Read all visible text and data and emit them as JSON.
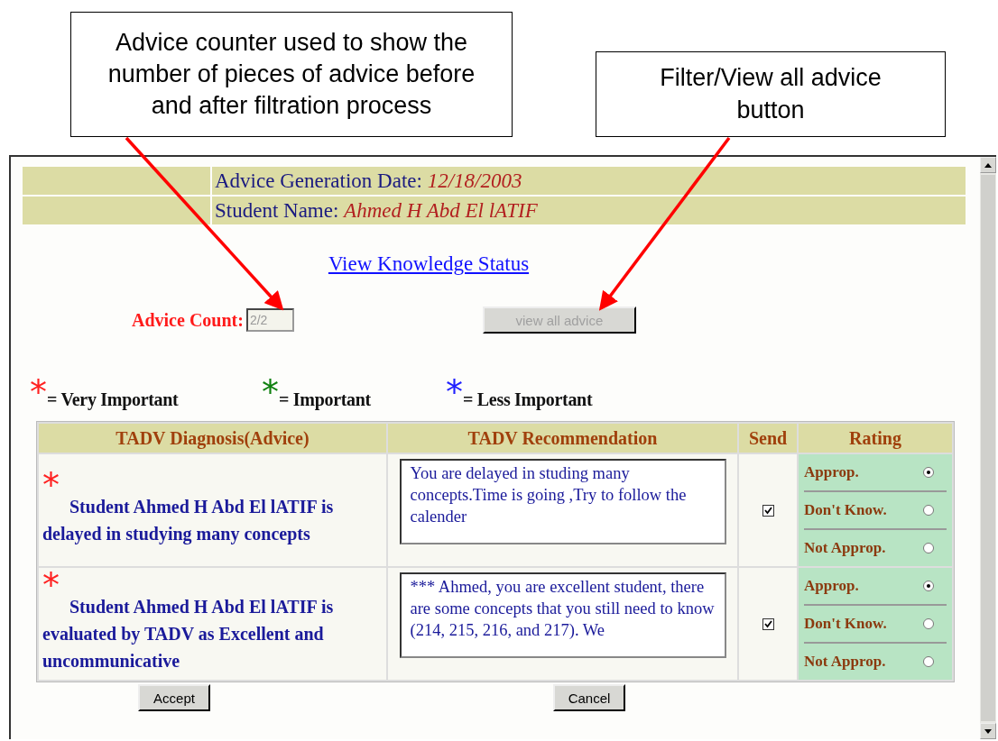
{
  "callouts": [
    {
      "text": "Advice counter used to show the number of pieces of advice before and after filtration process"
    },
    {
      "text": "Filter/View all advice button"
    }
  ],
  "header": {
    "date_label": "Advice Generation Date:",
    "date_value": "12/18/2003",
    "name_label": "Student Name:",
    "name_value": "Ahmed H Abd El lATIF"
  },
  "link": "View Knowledge Status",
  "advice_count": {
    "label": "Advice Count:",
    "value": "2/2"
  },
  "filter_button": {
    "label": "view all advice",
    "disabled": true
  },
  "legend": [
    {
      "symbol": "*",
      "color": "#ff2020",
      "label": "= Very Important"
    },
    {
      "symbol": "*",
      "color": "#108010",
      "label": "= Important"
    },
    {
      "symbol": "*",
      "color": "#2020ff",
      "label": "= Less Important"
    }
  ],
  "table": {
    "columns": [
      "TADV Diagnosis(Advice)",
      "TADV Recommendation",
      "Send",
      "Rating"
    ],
    "rows": [
      {
        "symbol": "*",
        "color": "#ff2020",
        "diagnosis": "Student Ahmed H Abd El lATIF is delayed in studying many concepts",
        "recommendation": "You are delayed in studing many concepts.Time is going ,Try to follow the calender",
        "send_checked": true,
        "ratings": [
          {
            "label": "Approp.",
            "selected": true
          },
          {
            "label": "Don't Know.",
            "selected": false
          },
          {
            "label": "Not Approp.",
            "selected": false
          }
        ]
      },
      {
        "symbol": "*",
        "color": "#ff2020",
        "diagnosis": "Student Ahmed H Abd El lATIF is evaluated by TADV as Excellent and uncommunicative",
        "recommendation": "*** Ahmed, you are excellent student, there are some concepts that you still need to know (214, 215, 216, and 217). We",
        "send_checked": true,
        "ratings": [
          {
            "label": "Approp.",
            "selected": true
          },
          {
            "label": "Don't Know.",
            "selected": false
          },
          {
            "label": "Not Approp.",
            "selected": false
          }
        ]
      }
    ]
  },
  "buttons": [
    "Accept",
    "Cancel"
  ]
}
